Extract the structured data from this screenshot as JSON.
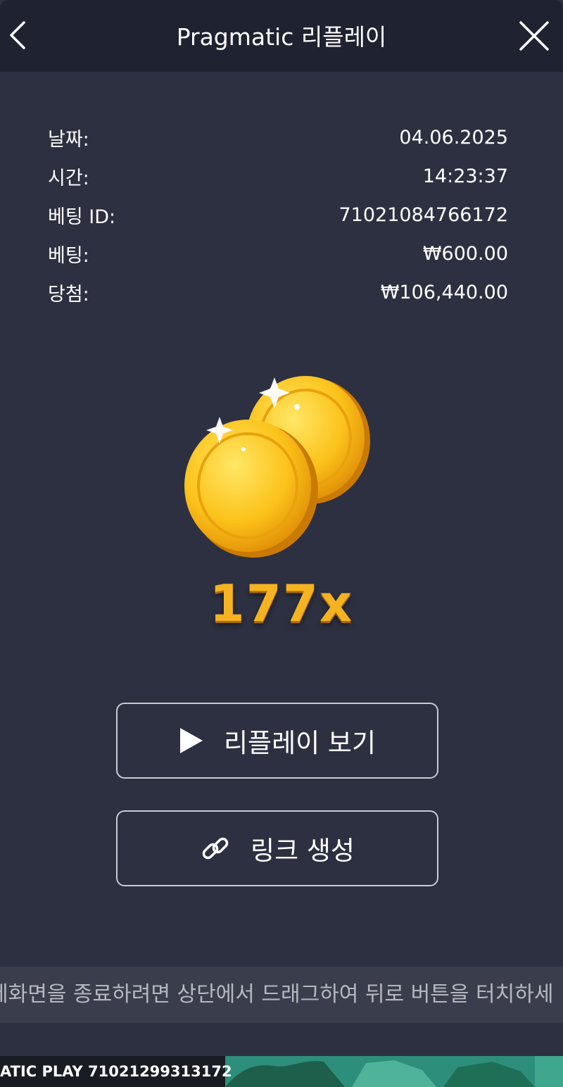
{
  "header": {
    "title": "Pragmatic 리플레이",
    "back_icon": "chevron-left-icon",
    "close_icon": "close-icon"
  },
  "info": {
    "rows": [
      {
        "label": "날짜:",
        "value": "04.06.2025"
      },
      {
        "label": "시간:",
        "value": "14:23:37"
      },
      {
        "label": "베팅 ID:",
        "value": "71021084766172"
      },
      {
        "label": "베팅:",
        "value": "₩600.00"
      },
      {
        "label": "당첨:",
        "value": "₩106,440.00"
      }
    ]
  },
  "result": {
    "multiplier": "177x",
    "image": "gold-coins-icon"
  },
  "buttons": {
    "replay_label": "리플레이 보기",
    "replay_icon": "play-icon",
    "link_label": "링크 생성",
    "link_icon": "link-icon"
  },
  "notice": {
    "text": "세화면을 종료하려면 상단에서 드래그하여 뒤로 버튼을 터치하세"
  },
  "game_strip": {
    "text": "ATIC PLAY  71021299313172"
  },
  "colors": {
    "header_bg": "#1f2230",
    "panel_bg": "#2d3040",
    "multiplier": "#f6b321",
    "notice_bg": "#3a3e4c"
  }
}
